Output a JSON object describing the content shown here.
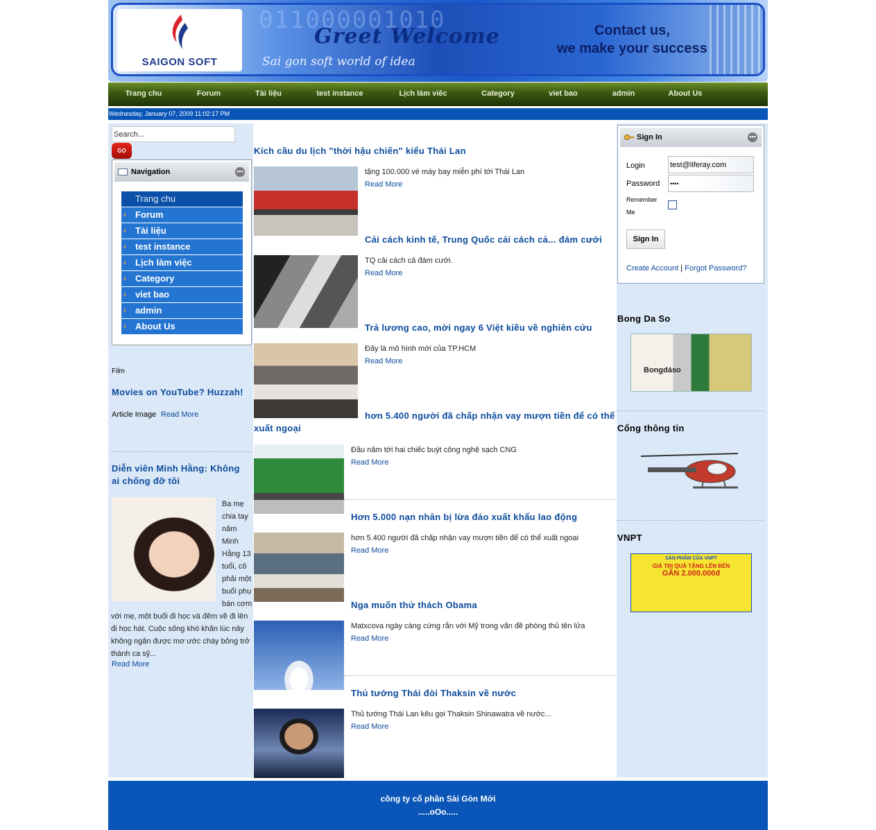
{
  "banner": {
    "logo_text": "SAIGON SOFT",
    "binary_text": "011000001010",
    "welcome_text": "Greet  Welcome",
    "tagline": "Sai gon soft world of idea",
    "slogan_line1": "Contact us,",
    "slogan_line2": "we make your success"
  },
  "topnav": {
    "items": [
      "Trang chu",
      "Forum",
      "Tài liệu",
      "test instance",
      "Lịch làm viêc",
      "Category",
      "viet bao",
      "admin",
      "About Us"
    ]
  },
  "datebar": {
    "text": "Wednesday, January 07, 2009 11:02:17 PM"
  },
  "left": {
    "search_placeholder": "Search...",
    "go_label": "GO",
    "nav_portlet_title": "Navigation",
    "nav_items": [
      "Trang chu",
      "Forum",
      "Tài liệu",
      "test instance",
      "Lịch làm việc",
      "Category",
      "viet bao",
      "admin",
      "About Us"
    ],
    "film_label": "Film",
    "film_title": "Movies on YouTube? Huzzah!",
    "film_caption": "Article Image",
    "film_readmore": "Read More",
    "actress_title": "Diễn viên Minh Hằng: Không ai chống đỡ tôi",
    "actress_text_right": "Ba mẹ chia tay năm Minh Hằng 13 tuổi, cô phải một buổi phụ bán cơm",
    "actress_text_bottom": "với mẹ, một buổi đi học và đêm về đi lên đi học hát. Cuộc sống khó khăn lúc nảy không ngăn được mơ ước cháy bỏng trở thành ca sỹ...",
    "actress_readmore": "Read More"
  },
  "articles": [
    {
      "title": "Kích cầu du lịch \"thời hậu chiến\" kiểu Thái Lan",
      "summary": "tặng 100.000 vé máy bay miễn phí tới Thái Lan",
      "readmore": "Read More"
    },
    {
      "title": "Cải cách kinh tế, Trung Quốc cải cách cả... đám cưới",
      "summary": "TQ cải cách cả đám cưới.",
      "readmore": "Read More"
    },
    {
      "title": "Trả lương cao, mời ngay 6 Việt kiều về nghiên cứu",
      "summary": "Đây là mô hình mới của TP.HCM",
      "readmore": "Read More"
    },
    {
      "title": "hơn 5.400 người đã chấp nhận vay mượn tiền để có thể xuất ngoại",
      "summary": "Đầu năm tới hai chiếc buýt công nghệ sạch CNG",
      "readmore": "Read More"
    },
    {
      "title": "Hơn 5.000 nạn nhân bị lừa đảo xuất khẩu lao động",
      "summary": "hơn 5.400 người đã chấp nhận vay mượn tiền để có thể xuất ngoại",
      "readmore": "Read More"
    },
    {
      "title": "Nga muốn thử thách Obama",
      "summary": "Matxcova ngày càng cứng rắn với Mỹ trong vấn đề phòng thủ tên lửa",
      "readmore": "Read More"
    },
    {
      "title": "Thủ tướng Thái đòi Thaksin về nước",
      "summary": "Thủ tướng Thái Lan kêu gọi Thaksin Shinawatra về nước...",
      "readmore": "Read More"
    }
  ],
  "signin": {
    "title": "Sign In",
    "login_label": "Login",
    "login_value": "test@liferay.com",
    "password_label": "Password",
    "password_value": "••••",
    "remember_label": "Remember Me",
    "button_label": "Sign In",
    "create_account": "Create Account",
    "separator": "|",
    "forgot_password": "Forgot Password?"
  },
  "right": {
    "bongdaso_title": "Bong Da So",
    "bongdaso_logo_text": "Bongdáso",
    "congthongtin_title": "Cổng thông tin",
    "vnpt_title": "VNPT",
    "vnpt_ad_line1": "SẢN PHẨM CỦA VNPT",
    "vnpt_ad_line2": "GIÁ TRỊ QUÀ TẶNG LÊN ĐẾN",
    "vnpt_ad_line3": "GẦN 2.000.000đ"
  },
  "footer": {
    "line1": "công ty cổ phần Sài Gòn Mới",
    "line2": ".....oOo....."
  },
  "colors": {
    "link_blue": "#0b4a9c",
    "nav_blue": "#2475d1",
    "date_bar": "#0a56b8",
    "top_nav_green": "#3e5c12",
    "side_bg": "#dbe8f7"
  }
}
